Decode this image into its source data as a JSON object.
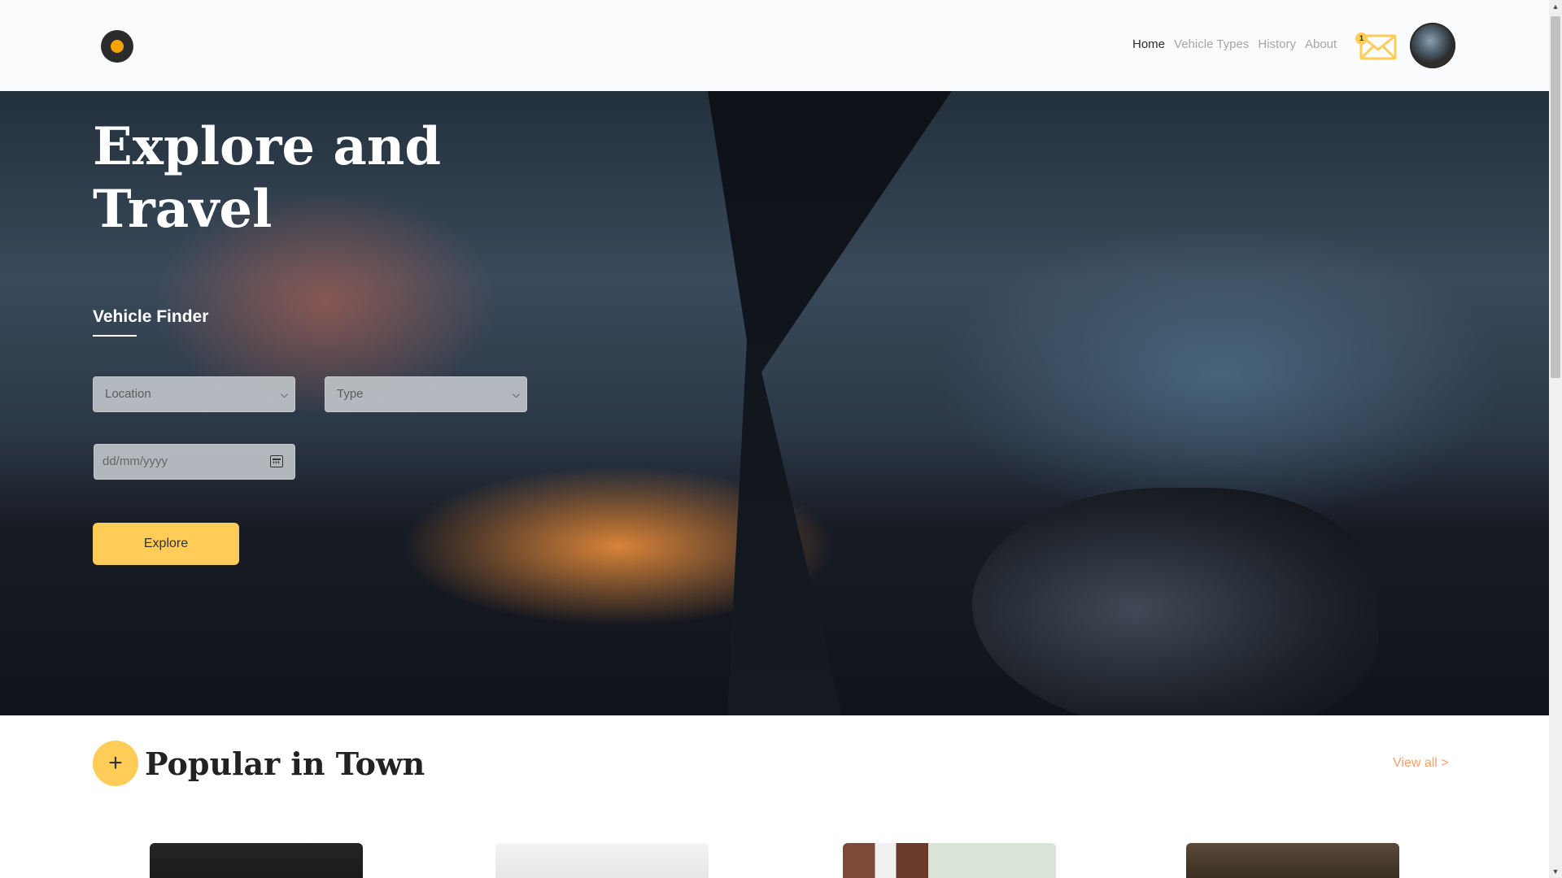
{
  "nav": {
    "items": [
      {
        "label": "Home"
      },
      {
        "label": "Vehicle Types"
      },
      {
        "label": "History"
      },
      {
        "label": "About"
      }
    ],
    "active": "Home",
    "notification_count": "1"
  },
  "hero": {
    "title": "Explore and Travel",
    "finder_label": "Vehicle Finder",
    "location_select": "Location",
    "type_select": "Type",
    "date_placeholder": "dd/mm/yyyy",
    "explore_button": "Explore"
  },
  "popular": {
    "plus_symbol": "+",
    "title": "Popular in Town",
    "view_all": "View all  >"
  },
  "colors": {
    "accent": "#ffcd57",
    "link": "#f7a06b"
  }
}
